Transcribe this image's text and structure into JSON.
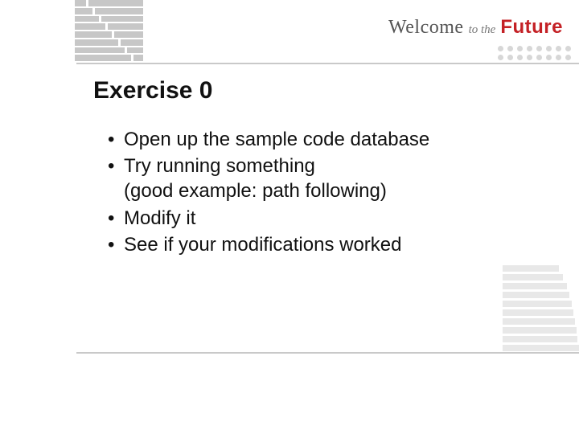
{
  "brand": {
    "welcome": "Welcome",
    "to_the": "to the",
    "future": "Future"
  },
  "title": "Exercise 0",
  "bullets": [
    {
      "text": "Open up the sample code database",
      "sub": null
    },
    {
      "text": "Try running something",
      "sub": "(good example: path following)"
    },
    {
      "text": "Modify it",
      "sub": null
    },
    {
      "text": "See if your modifications worked",
      "sub": null
    }
  ]
}
